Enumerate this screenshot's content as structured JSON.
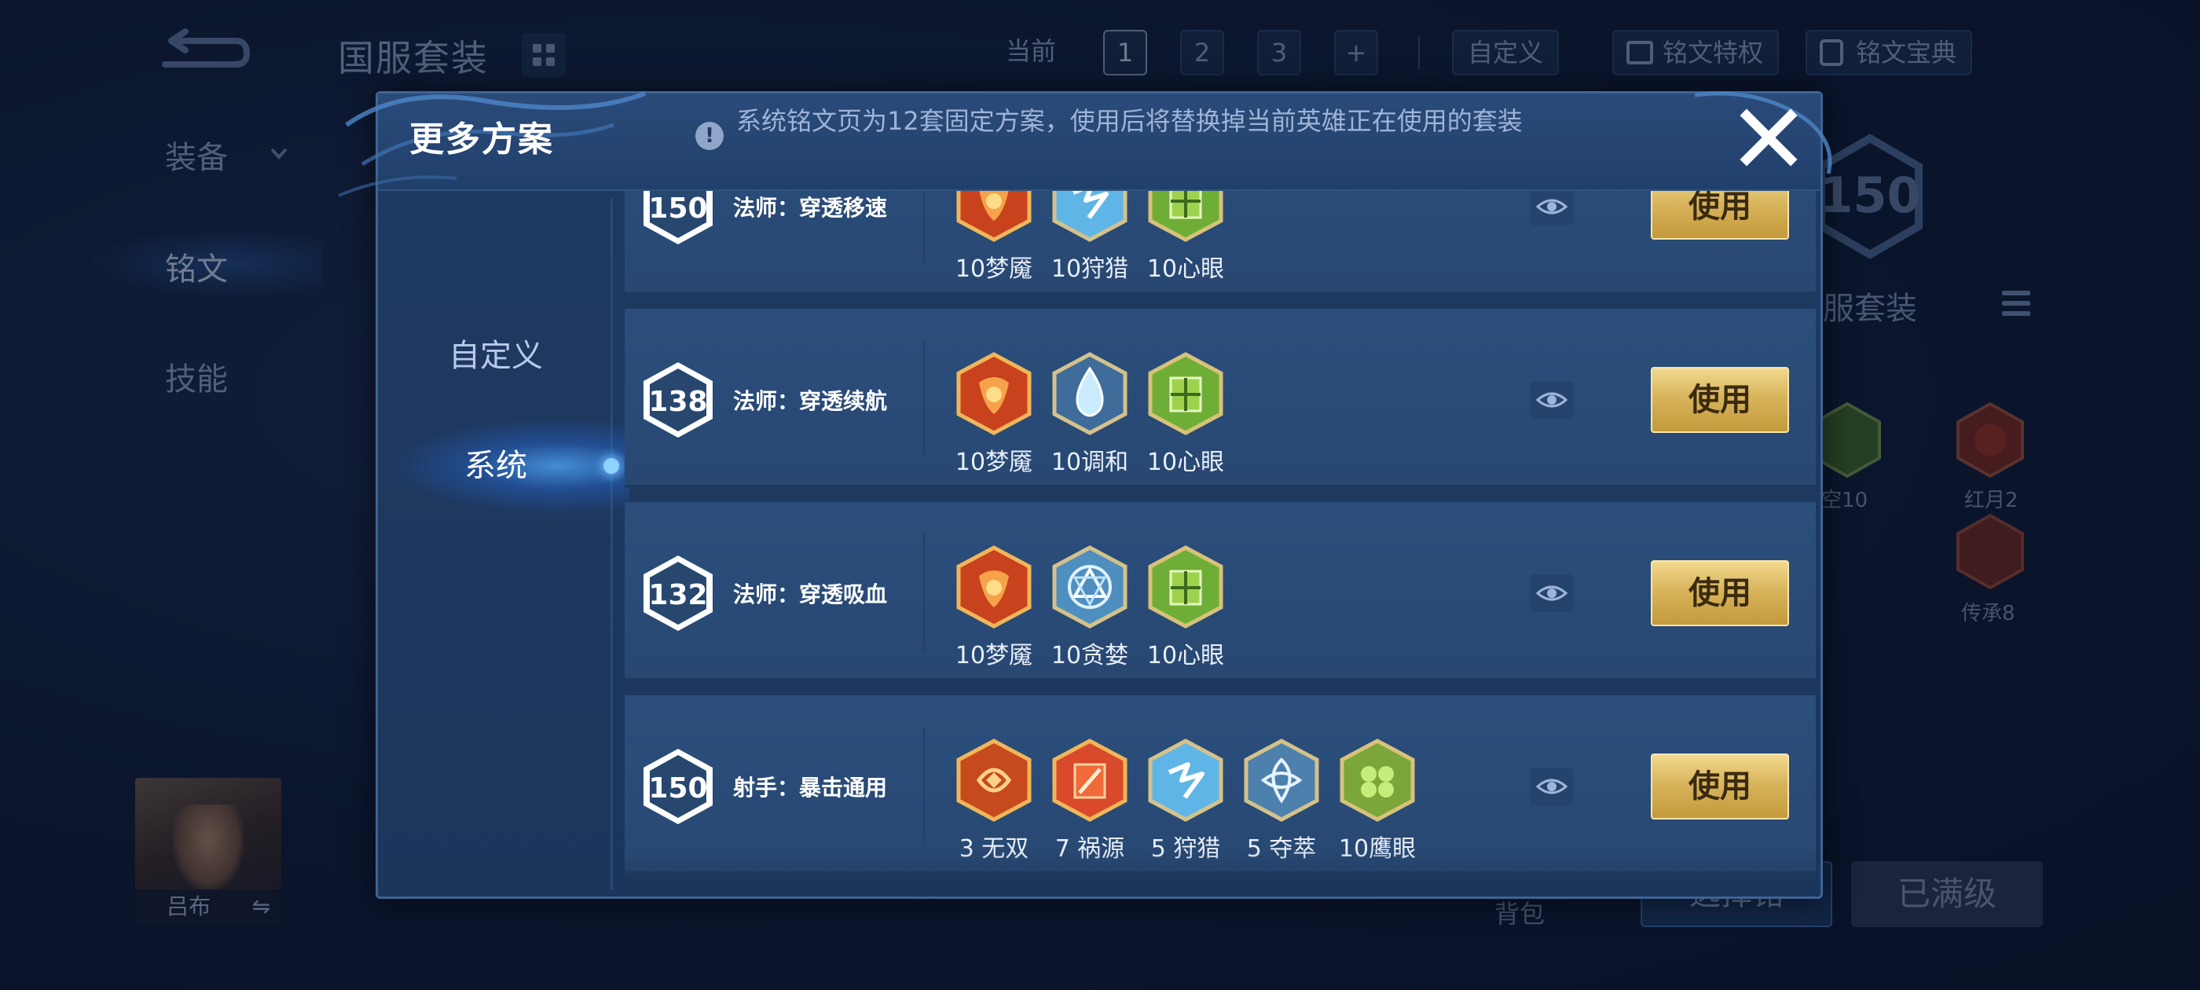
{
  "background": {
    "title": "国服套装",
    "top_buttons": [
      "当前",
      "1",
      "2",
      "3",
      "+",
      "自定义"
    ],
    "feature_buttons": [
      "铭文特权",
      "铭文宝典"
    ],
    "sidebar": [
      "装备",
      "铭文",
      "技能"
    ],
    "level": "150",
    "set_label": "服套装",
    "runes": [
      {
        "label": "空10"
      },
      {
        "label": "红月2"
      },
      {
        "label": "传承8"
      }
    ],
    "hero_name": "吕布",
    "swap_symbol": "⇋",
    "bag_label": "背包",
    "select_button": "选择铭",
    "max_button": "已满级"
  },
  "modal": {
    "title": "更多方案",
    "info_icon": "!",
    "info_text": "系统铭文页为12套固定方案，使用后将替换掉当前英雄正在使用的套装",
    "nav": [
      {
        "label": "自定义",
        "active": false
      },
      {
        "label": "系统",
        "active": true
      }
    ],
    "rows": [
      {
        "level": "150",
        "name": "法师：穿透移速",
        "runes": [
          {
            "icon": "mengyan-rune-icon",
            "label": "10梦魇"
          },
          {
            "icon": "shoulie-rune-icon",
            "label": "10狩猎"
          },
          {
            "icon": "xinyan-rune-icon",
            "label": "10心眼"
          }
        ],
        "use_label": "使用"
      },
      {
        "level": "138",
        "name": "法师：穿透续航",
        "runes": [
          {
            "icon": "mengyan-rune-icon",
            "label": "10梦魇"
          },
          {
            "icon": "tiaohe-rune-icon",
            "label": "10调和"
          },
          {
            "icon": "xinyan-rune-icon",
            "label": "10心眼"
          }
        ],
        "use_label": "使用"
      },
      {
        "level": "132",
        "name": "法师：穿透吸血",
        "runes": [
          {
            "icon": "mengyan-rune-icon",
            "label": "10梦魇"
          },
          {
            "icon": "tanlan-rune-icon",
            "label": "10贪婪"
          },
          {
            "icon": "xinyan-rune-icon",
            "label": "10心眼"
          }
        ],
        "use_label": "使用"
      },
      {
        "level": "150",
        "name": "射手：暴击通用",
        "runes": [
          {
            "icon": "wushuang-rune-icon",
            "label": "3 无双"
          },
          {
            "icon": "huoyuan-rune-icon",
            "label": "7 祸源"
          },
          {
            "icon": "shoulie-rune-icon",
            "label": "5 狩猎"
          },
          {
            "icon": "duocui-rune-icon",
            "label": "5 夺萃"
          },
          {
            "icon": "yingyan-rune-icon",
            "label": "10鹰眼"
          }
        ],
        "use_label": "使用"
      }
    ]
  },
  "colors": {
    "gold_button": "#d8b45c",
    "panel": "#1f3a62",
    "row": "#2b4e7c",
    "red_rune": "#c8421e",
    "blue_rune": "#5fb6e6",
    "green_rune": "#6fae36"
  }
}
